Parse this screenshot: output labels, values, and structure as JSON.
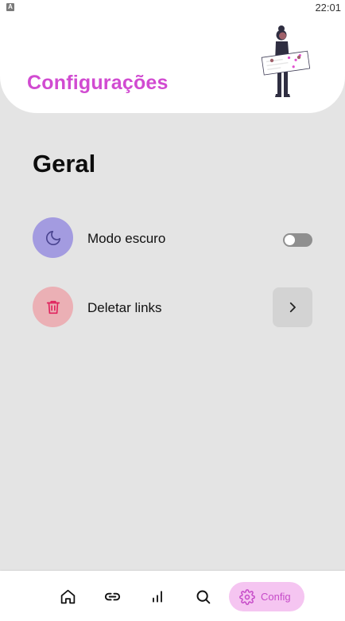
{
  "status_bar": {
    "time": "22:01",
    "app_icon_glyph": "A"
  },
  "header": {
    "title": "Configurações"
  },
  "main": {
    "section_title": "Geral",
    "settings": [
      {
        "label": "Modo escuro",
        "icon": "moon-icon",
        "icon_bg": "#a39be0",
        "toggle_on": false
      },
      {
        "label": "Deletar links",
        "icon": "trash-icon",
        "icon_bg": "#ebb0b5",
        "action_icon": "chevron-right-icon"
      }
    ]
  },
  "bottom_nav": {
    "items": [
      {
        "icon": "home-icon"
      },
      {
        "icon": "link-icon"
      },
      {
        "icon": "bar-chart-icon"
      },
      {
        "icon": "search-icon"
      },
      {
        "icon": "gear-icon",
        "label": "Config",
        "active": true
      }
    ]
  },
  "colors": {
    "accent": "#d14bd1",
    "background": "#e4e4e4",
    "nav_active_bg": "#f5c5f1",
    "delete_icon": "#e0245e",
    "moon_icon": "#4a4490"
  }
}
